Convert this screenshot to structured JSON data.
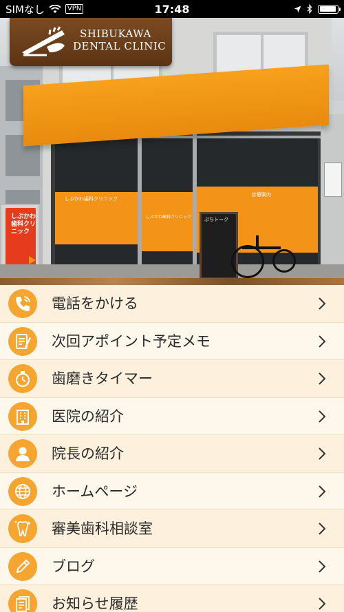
{
  "status_bar": {
    "carrier": "SIMなし",
    "vpn": "VPN",
    "time": "17:48",
    "battery_level": 0.95
  },
  "header": {
    "logo_line1": "SHIBUKAWA",
    "logo_line2": "DENTAL CLINIC"
  },
  "photo_signage": {
    "side_sign": "しぶかわ歯科クリニック",
    "window_left_title": "しぶかわ歯科クリニック",
    "window_center_title": "しぶかわ歯科クリニック",
    "window_right_title": "診療案内",
    "chalkboard_title": "ぷちトーク"
  },
  "menu": {
    "items": [
      {
        "label": "電話をかける",
        "icon": "phone-icon"
      },
      {
        "label": "次回アポイント予定メモ",
        "icon": "memo-icon"
      },
      {
        "label": "歯磨きタイマー",
        "icon": "stopwatch-icon"
      },
      {
        "label": "医院の紹介",
        "icon": "building-icon"
      },
      {
        "label": "院長の紹介",
        "icon": "person-icon"
      },
      {
        "label": "ホームページ",
        "icon": "globe-icon"
      },
      {
        "label": "審美歯科相談室",
        "icon": "tooth-icon"
      },
      {
        "label": "ブログ",
        "icon": "pencil-icon"
      },
      {
        "label": "お知らせ履歴",
        "icon": "document-icon"
      }
    ]
  },
  "colors": {
    "accent_orange": "#f5a530",
    "row_odd": "#fdf0dc",
    "row_even": "#fef7ec",
    "logo_brown": "#6b3f1b"
  }
}
